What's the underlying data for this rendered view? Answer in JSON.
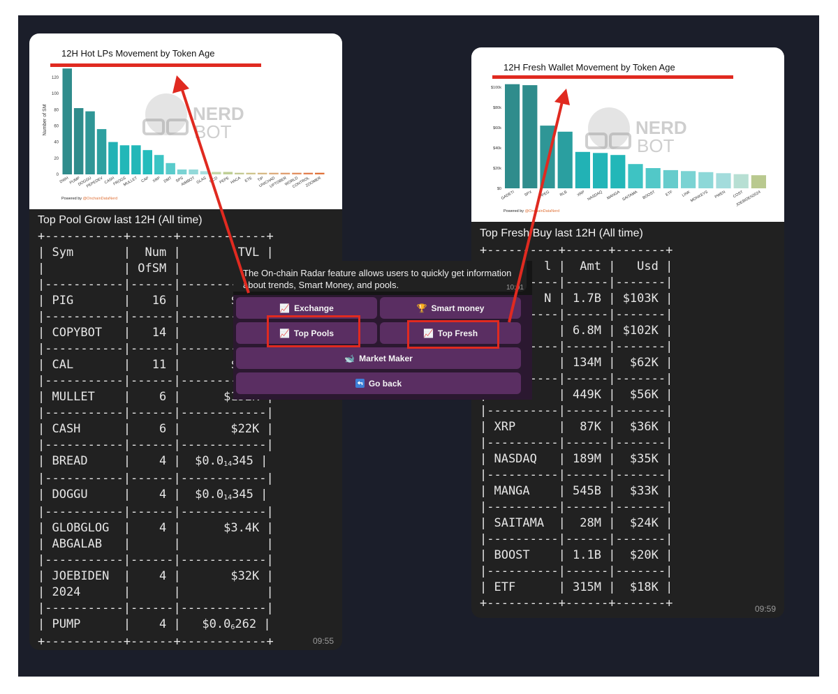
{
  "left": {
    "chart_title": "12H Hot LPs Movement by Token Age",
    "ylabel": "Number of SM",
    "watermark": {
      "line1": "NERD",
      "line2": "BOT"
    },
    "powered_prefix": "Powered by",
    "powered_handle": "@OnchainDataNerd",
    "title": "Top Pool Grow last 12H (All time)",
    "time": "09:55",
    "table": {
      "headers": [
        "Sym",
        "Num",
        "TVL"
      ],
      "headers2": [
        "",
        "OfSM",
        ""
      ],
      "rows": [
        {
          "sym": "PIG",
          "num": "16",
          "tvl": "$3.7"
        },
        {
          "sym": "COPYBOT",
          "num": "14",
          "tvl": "$47"
        },
        {
          "sym": "CAL",
          "num": "11",
          "tvl": "$1.1"
        },
        {
          "sym": "MULLET",
          "num": "6",
          "tvl": "$152K"
        },
        {
          "sym": "CASH",
          "num": "6",
          "tvl": "$22K"
        },
        {
          "sym": "BREAD",
          "num": "4",
          "tvl": "$0.0₁₄345"
        },
        {
          "sym": "DOGGU",
          "num": "4",
          "tvl": "$0.0₁₄345"
        },
        {
          "sym": "GLOBGLOG",
          "sym2": "ABGALAB",
          "num": "4",
          "tvl": "$3.4K"
        },
        {
          "sym": "JOEBIDEN",
          "sym2": "2024",
          "num": "4",
          "tvl": "$32K"
        },
        {
          "sym": "PUMP",
          "num": "4",
          "tvl": "$0.0₆262"
        }
      ]
    }
  },
  "right": {
    "chart_title": "12H Fresh Wallet Movement by Token Age",
    "watermark": {
      "line1": "NERD",
      "line2": "BOT"
    },
    "powered_prefix": "Powered by",
    "powered_handle": "@OnchainDataNerd",
    "title": "Top Fresh Buy last 12H (All time)",
    "time": "09:59",
    "table": {
      "headers": [
        "l",
        "Amt",
        "Usd"
      ],
      "rows": [
        {
          "sym": "N",
          "amt": "1.7B",
          "usd": "$103K"
        },
        {
          "sym": "",
          "amt": "6.8M",
          "usd": "$102K"
        },
        {
          "sym": "",
          "amt": "134M",
          "usd": "$62K"
        },
        {
          "sym": "",
          "amt": "449K",
          "usd": "$56K"
        },
        {
          "sym": "XRP",
          "amt": "87K",
          "usd": "$36K"
        },
        {
          "sym": "NASDAQ",
          "amt": "189M",
          "usd": "$35K"
        },
        {
          "sym": "MANGA",
          "amt": "545B",
          "usd": "$33K"
        },
        {
          "sym": "SAITAMA",
          "amt": "28M",
          "usd": "$24K"
        },
        {
          "sym": "BOOST",
          "amt": "1.1B",
          "usd": "$20K"
        },
        {
          "sym": "ETF",
          "amt": "315M",
          "usd": "$18K"
        }
      ]
    }
  },
  "popup": {
    "text": "The On-chain Radar feature allows users to quickly get information about trends, Smart Money, and pools.",
    "time": "10:01",
    "buttons": {
      "exchange": "Exchange",
      "smart_money": "Smart money",
      "top_pools": "Top Pools",
      "top_fresh": "Top Fresh",
      "market_maker": "Market Maker",
      "go_back": "Go back"
    },
    "icons": {
      "exchange": "chart-increasing-icon",
      "smart_money": "trophy-icon",
      "top_pools": "chart-increasing-icon",
      "top_fresh": "chart-increasing-icon",
      "market_maker": "whale-icon",
      "go_back": "back-arrow-icon"
    }
  },
  "colors": {
    "highlight": "#e02a20",
    "teal_dark": "#2f8c8c",
    "teal": "#22b5b8",
    "teal_light": "#7ad3d3",
    "olive": "#b9c98f",
    "orange": "#e0733a",
    "keyboard_button": "#5a2e62"
  },
  "chart_data": [
    {
      "type": "bar",
      "title": "12H Hot LPs Movement by Token Age",
      "ylabel": "Number of SM",
      "xlabel": "",
      "ylim": [
        0,
        132
      ],
      "yticks": [
        0,
        20,
        40,
        60,
        80,
        100,
        120
      ],
      "categories": [
        "DWH",
        "PUMP",
        "DOGGU",
        "PEPEDEV",
        "CASH",
        "FROGS",
        "MULLET",
        "CAP",
        "XRP",
        "DMT",
        "SPS",
        "AIMBOT",
        "GLAS",
        "OCD",
        "PEPE",
        "HACA",
        "ETE",
        "TIP",
        "UNICHAD",
        "UPTOBER",
        "WORLD",
        "CONTROL",
        "ZOOMER"
      ],
      "values": [
        131,
        82,
        78,
        56,
        40,
        36,
        36,
        30,
        24,
        14,
        6,
        6,
        4,
        3,
        3,
        2,
        2,
        2,
        2,
        2,
        2,
        2,
        2
      ]
    },
    {
      "type": "bar",
      "title": "12H Fresh Wallet Movement by Token Age",
      "xlabel": "",
      "ylabel": "",
      "ylim": [
        0,
        100
      ],
      "ytick_values": [
        0,
        20,
        40,
        60,
        80,
        100
      ],
      "ytick_labels": [
        "$0",
        "$20k",
        "$40k",
        "$60k",
        "$80k",
        "$100k"
      ],
      "categories": [
        "GADETI",
        "SPX",
        "PPEG",
        "RLB",
        "XRP",
        "NASDAQ",
        "MANGA",
        "SAITAMA",
        "BOOST",
        "ETF",
        "LINK",
        "MONKEYS",
        "PWEN",
        "COST",
        "JOEBIDEN2024"
      ],
      "values": [
        103,
        102,
        62,
        56,
        36,
        35,
        33,
        24,
        20,
        18,
        17,
        16,
        15,
        14,
        13
      ]
    }
  ]
}
